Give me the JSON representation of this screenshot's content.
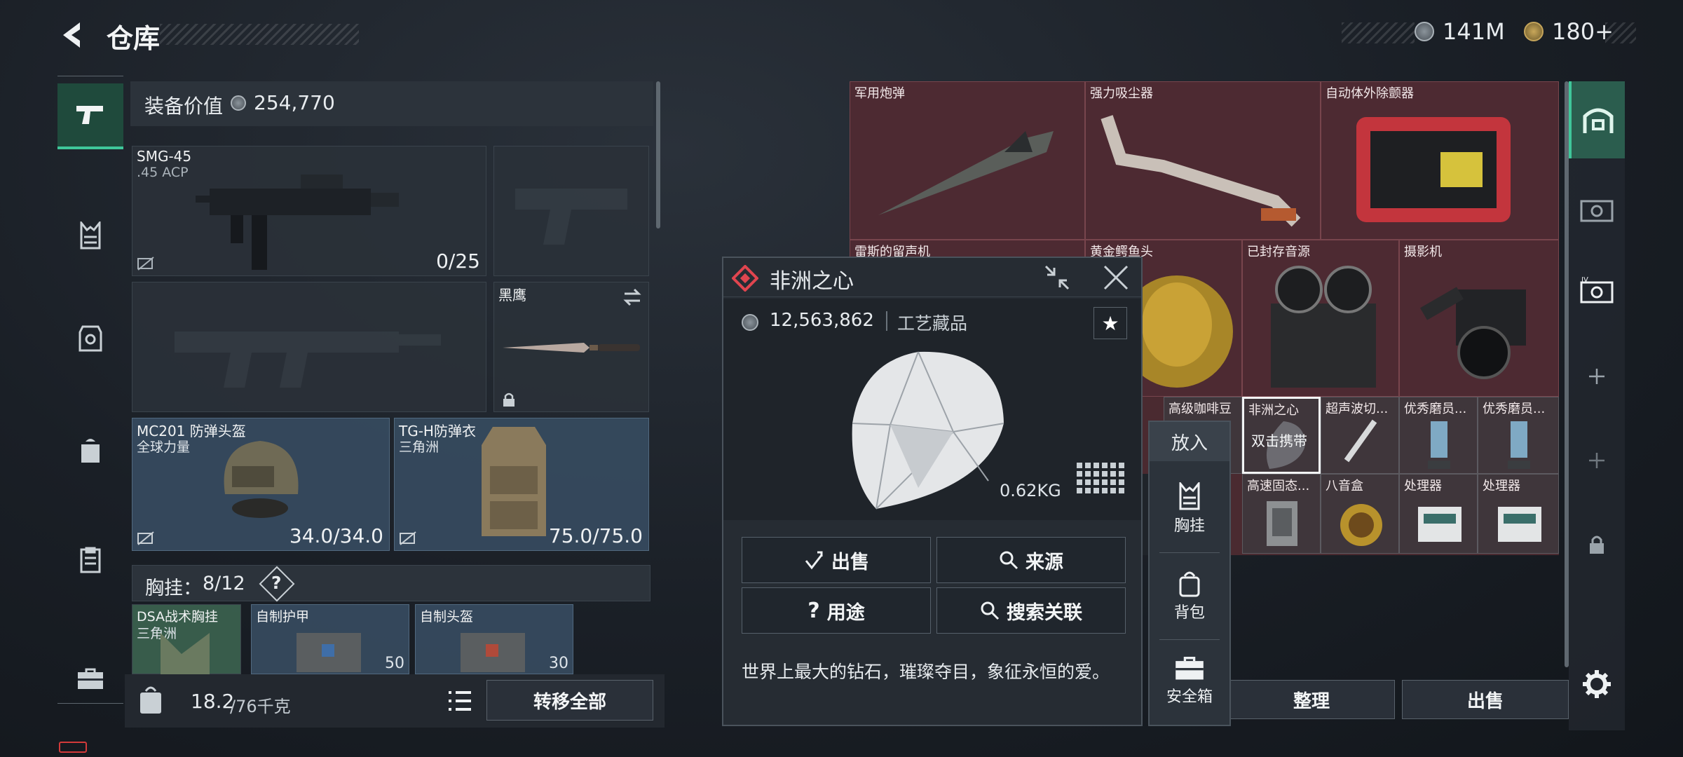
{
  "header": {
    "title": "仓库",
    "currency_silver": "141M",
    "currency_gold": "180+"
  },
  "loadout": {
    "value_label": "装备价值",
    "value": "254,770",
    "primary": {
      "name": "SMG-45",
      "ammo": ".45 ACP",
      "count": "0/25"
    },
    "melee": {
      "name": "黑鹰"
    },
    "helmet": {
      "name": "MC201 防弹头盔",
      "brand": "全球力量",
      "durability": "34.0/34.0"
    },
    "armor": {
      "name": "TG-H防弹衣",
      "brand": "三角洲",
      "durability": "75.0/75.0"
    },
    "rig_label": "胸挂：",
    "rig_count": "8/12",
    "rig_help": "?",
    "rig_items": [
      {
        "name": "DSA战术胸挂",
        "brand": "三角洲"
      },
      {
        "name": "自制护甲",
        "val": "50"
      },
      {
        "name": "自制头盔",
        "val": "30"
      }
    ],
    "weight": "18.2",
    "weight_cap": "/76千克",
    "transfer_all": "转移全部"
  },
  "storage": {
    "items": [
      {
        "name": "军用炮弹"
      },
      {
        "name": "强力吸尘器"
      },
      {
        "name": "自动体外除颤器"
      },
      {
        "name": "雷斯的留声机"
      },
      {
        "name": "黄金鳄鱼头"
      },
      {
        "name": "已封存音源"
      },
      {
        "name": "摄影机"
      },
      {
        "name": "高级咖啡豆"
      },
      {
        "name": "非洲之心"
      },
      {
        "name": "超声波切..."
      },
      {
        "name": "优秀磨员..."
      },
      {
        "name": "优秀磨员..."
      },
      {
        "name": "高速固态..."
      },
      {
        "name": "八音盒"
      },
      {
        "name": "处理器"
      },
      {
        "name": "处理器"
      }
    ],
    "selected_overlay": "双击携带",
    "sort_label": "整理",
    "sell_label": "出售"
  },
  "popup": {
    "title": "非洲之心",
    "price": "12,563,862",
    "category": "工艺藏品",
    "weight": "0.62KG",
    "actions": {
      "sell": "出售",
      "source": "来源",
      "usage": "用途",
      "search": "搜索关联"
    },
    "description": "世界上最大的钻石，璀璨夺目，象征永恒的爱。",
    "star": "★"
  },
  "drop_menu": {
    "header": "放入",
    "items": [
      {
        "label": "胸挂"
      },
      {
        "label": "背包"
      },
      {
        "label": "安全箱"
      }
    ]
  },
  "colors": {
    "accent": "#3fc79a",
    "storage_bg": "#4a2a30",
    "blue_cell": "#364a5e",
    "popup_icon": "#e0454f"
  }
}
